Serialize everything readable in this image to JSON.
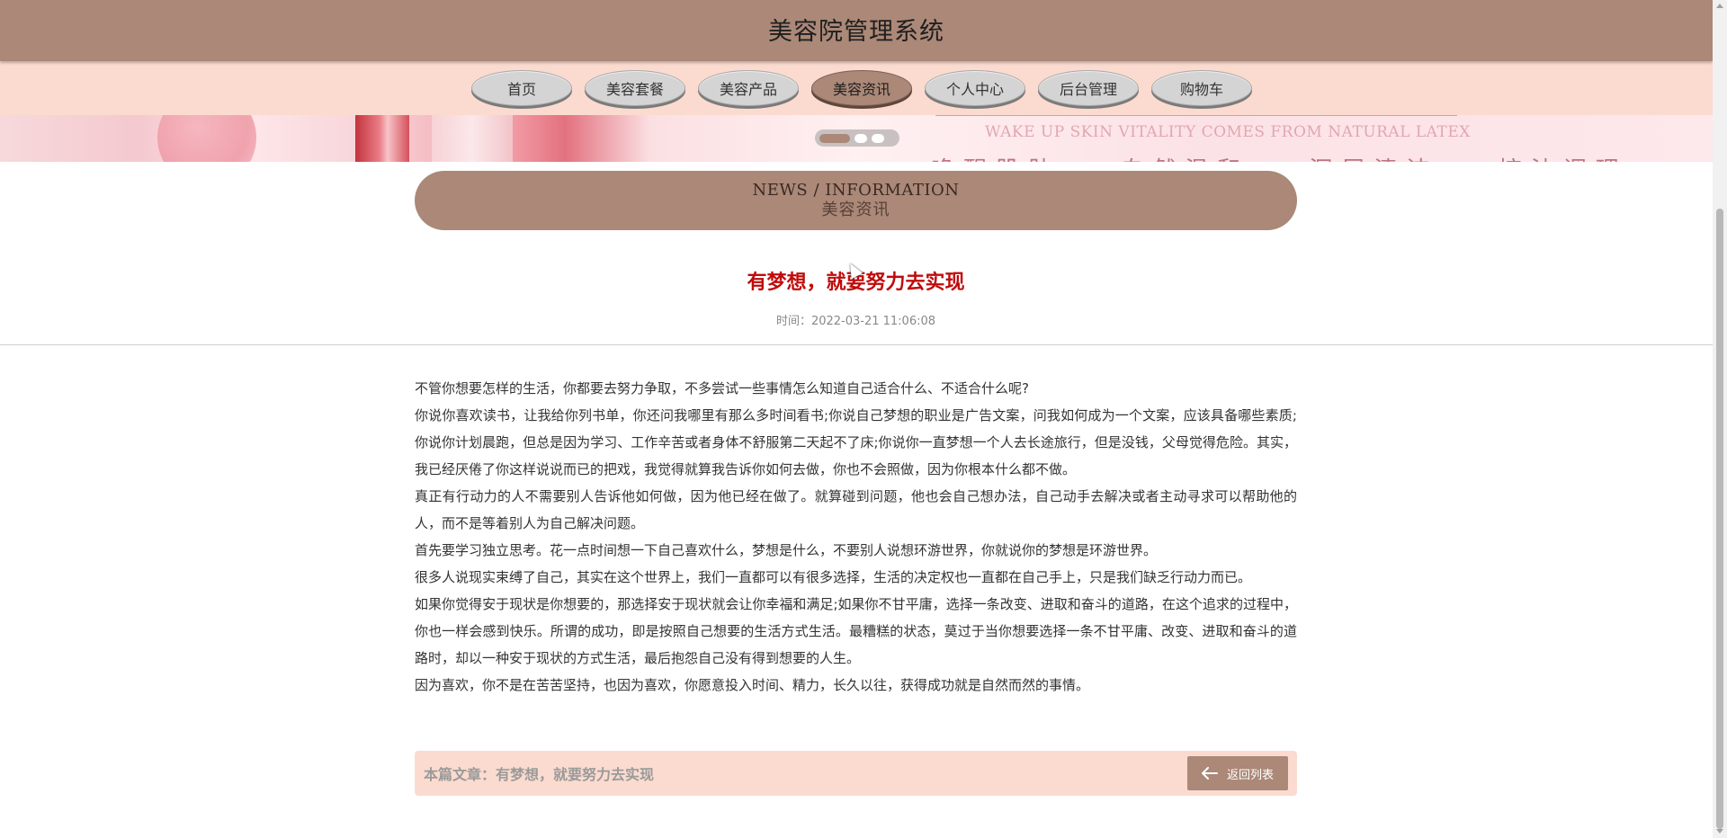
{
  "header": {
    "title": "美容院管理系统"
  },
  "nav": {
    "items": [
      {
        "label": "首页"
      },
      {
        "label": "美容套餐"
      },
      {
        "label": "美容产品"
      },
      {
        "label": "美容资讯",
        "active": true
      },
      {
        "label": "个人中心"
      },
      {
        "label": "后台管理"
      },
      {
        "label": "购物车"
      }
    ]
  },
  "banner": {
    "slogan": "WAKE UP SKIN VITALITY COMES FROM NATURAL LATEX",
    "cn_text": "唤醒肌肤 自然温和 深层清洁 控油调理",
    "slide_index": 1,
    "slide_count": 3
  },
  "section": {
    "en": "NEWS / INFORMATION",
    "cn": "美容资讯"
  },
  "article": {
    "title": "有梦想，就要努力去实现",
    "time": "时间：2022-03-21 11:06:08",
    "paragraphs": [
      "不管你想要怎样的生活，你都要去努力争取，不多尝试一些事情怎么知道自己适合什么、不适合什么呢?",
      "你说你喜欢读书，让我给你列书单，你还问我哪里有那么多时间看书;你说自己梦想的职业是广告文案，问我如何成为一个文案，应该具备哪些素质;你说你计划晨跑，但总是因为学习、工作辛苦或者身体不舒服第二天起不了床;你说你一直梦想一个人去长途旅行，但是没钱，父母觉得危险。其实，我已经厌倦了你这样说说而已的把戏，我觉得就算我告诉你如何去做，你也不会照做，因为你根本什么都不做。",
      "真正有行动力的人不需要别人告诉他如何做，因为他已经在做了。就算碰到问题，他也会自己想办法，自己动手去解决或者主动寻求可以帮助他的人，而不是等着别人为自己解决问题。",
      "首先要学习独立思考。花一点时间想一下自己喜欢什么，梦想是什么，不要别人说想环游世界，你就说你的梦想是环游世界。",
      "很多人说现实束缚了自己，其实在这个世界上，我们一直都可以有很多选择，生活的决定权也一直都在自己手上，只是我们缺乏行动力而已。",
      "如果你觉得安于现状是你想要的，那选择安于现状就会让你幸福和满足;如果你不甘平庸，选择一条改变、进取和奋斗的道路，在这个追求的过程中，你也一样会感到快乐。所谓的成功，即是按照自己想要的生活方式生活。最糟糕的状态，莫过于当你想要选择一条不甘平庸、改变、进取和奋斗的道路时，却以一种安于现状的方式生活，最后抱怨自己没有得到想要的人生。",
      "因为喜欢，你不是在苦苦坚持，也因为喜欢，你愿意投入时间、精力，长久以往，获得成功就是自然而然的事情。"
    ]
  },
  "footer": {
    "label": "本篇文章：有梦想，就要努力去实现",
    "back_label": "返回列表"
  },
  "colors": {
    "brand": "#ab8877",
    "light": "#fbdbcf",
    "title_red": "#c00b0b"
  }
}
